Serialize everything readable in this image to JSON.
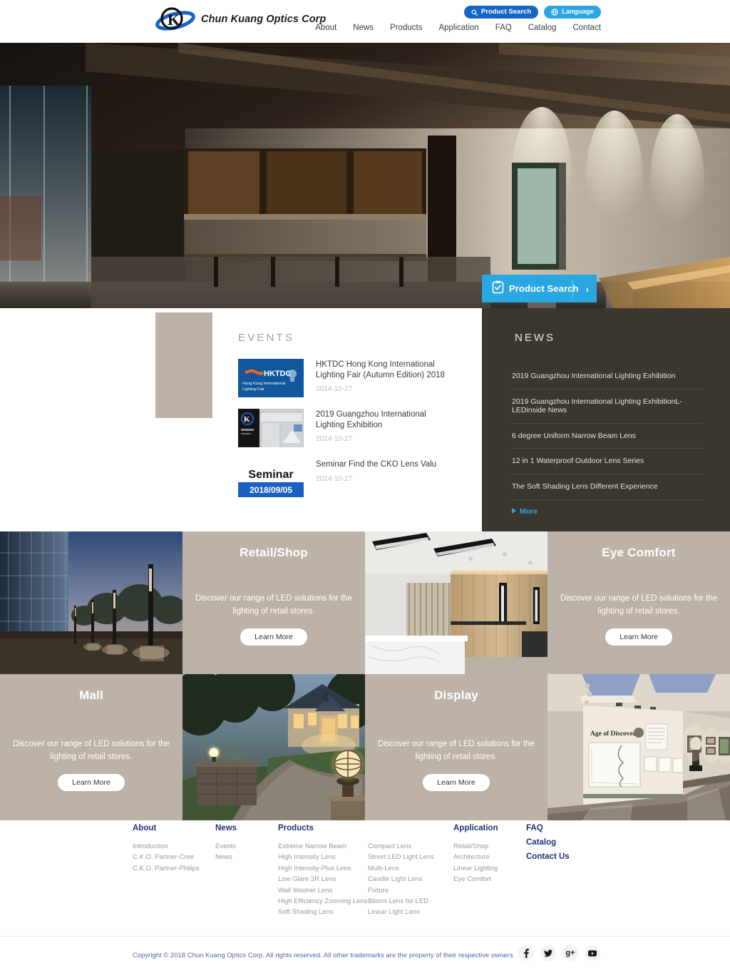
{
  "header": {
    "logo_text": "Chun Kuang Optics Corp",
    "buttons": [
      {
        "label": "Product Search",
        "icon": "search-icon",
        "color": "#1565c7"
      },
      {
        "label": "Language",
        "icon": "globe-icon",
        "color": "#2aa6e0"
      }
    ],
    "nav": [
      {
        "label": "About"
      },
      {
        "label": "News"
      },
      {
        "label": "Products"
      },
      {
        "label": "Application"
      },
      {
        "label": "FAQ"
      },
      {
        "label": "Catalog"
      },
      {
        "label": "Contact"
      }
    ]
  },
  "hero": {
    "cta_label": "Product Search",
    "cta_icon": "clipboard-check-icon",
    "cta_chevron": "›",
    "cta_color": "#2aa6e0"
  },
  "events": {
    "title": "EVENTS",
    "items": [
      {
        "title": "HKTDC Hong Kong International Lighting Fair (Autumn Edition) 2018",
        "date": "2014-10-27",
        "thumb_kind": "hktdc",
        "thumb_text": "HKTDC",
        "thumb_sub": "Hong Kong International Lighting Fair"
      },
      {
        "title": "2019 Guangzhou International Lighting Exhibition",
        "date": "2014-10-27",
        "thumb_kind": "booth",
        "thumb_text": "",
        "thumb_sub": ""
      },
      {
        "title": "Seminar Find the CKO Lens Valu",
        "date": "2014-10-27",
        "thumb_kind": "seminar",
        "thumb_text": "Seminar",
        "thumb_sub": "2018/09/05"
      }
    ]
  },
  "news": {
    "title": "NEWS",
    "items": [
      {
        "label": "2019 Guangzhou International Lighting Exhibition"
      },
      {
        "label": "2019 Guangzhou International Lighting ExhibitionL-LEDinside News"
      },
      {
        "label": "6 degree Uniform Narrow Beam Lens"
      },
      {
        "label": "12 in 1 Waterproof Outdoor Lens Series"
      },
      {
        "label": "The Soft Shading Lens Different Experience"
      }
    ],
    "more_label": "More",
    "more_color": "#2aa6e0"
  },
  "tiles": [
    {
      "kind": "image",
      "image": "outdoor-poles",
      "title": "",
      "desc": "",
      "button": ""
    },
    {
      "kind": "text",
      "title": "Retail/Shop",
      "desc": "Discover our range of LED solutions for the lighting of retail stores.",
      "button": "Learn More"
    },
    {
      "kind": "image",
      "image": "office-interior",
      "title": "",
      "desc": "",
      "button": ""
    },
    {
      "kind": "text",
      "title": "Eye Comfort",
      "desc": "Discover our range of LED solutions for the lighting of retail stores.",
      "button": "Learn More"
    },
    {
      "kind": "text",
      "title": "Mall",
      "desc": "Discover our range of LED solutions for the lighting of retail stores.",
      "button": "Learn More"
    },
    {
      "kind": "image",
      "image": "house-garden",
      "title": "",
      "desc": "",
      "button": ""
    },
    {
      "kind": "text",
      "title": "Display",
      "desc": "Discover our range of LED solutions for the lighting of retail stores.",
      "button": "Learn More"
    },
    {
      "kind": "image",
      "image": "museum-gallery",
      "title": "",
      "desc": "",
      "button": ""
    }
  ],
  "footer": {
    "columns": [
      {
        "head": "About",
        "links": [
          "Introduction",
          "C.K.O. Partner-Cree",
          "C.K.O. Partner-Philips"
        ]
      },
      {
        "head": "News",
        "links": [
          "Events",
          "News"
        ]
      }
    ],
    "products": {
      "head": "Products",
      "col_a": [
        "Extreme Narrow Beam",
        "High Intensity Lens",
        "High Intensity-Plus Lens",
        "Low Glare 3R Lens",
        "Wall Washer Lens",
        "High Efficiency Zooming Lens",
        "Soft Shading Lens"
      ],
      "col_b": [
        "Compact Lens",
        "Street LED Light Lens",
        "Multi-Lens",
        "Candle Light Lens",
        "Fixture",
        "Bloom Lens for LED",
        "Linear Light Lens"
      ]
    },
    "application": {
      "head": "Application",
      "links": [
        "Retail/Shop",
        "Architecture",
        "Linear Lighting",
        "Eye Comfort"
      ]
    },
    "solo_links": [
      "FAQ",
      "Catalog",
      "Contact Us"
    ],
    "copyright": "Copyright © 2018 Chun Kuang Optics Corp. All rights reserved. All other trademarks are the property of their respective owners.",
    "socials": [
      {
        "name": "facebook-icon",
        "glyph": "f"
      },
      {
        "name": "twitter-icon",
        "glyph": "t"
      },
      {
        "name": "google-plus-icon",
        "glyph": "g+"
      },
      {
        "name": "youtube-icon",
        "glyph": "yt"
      }
    ]
  }
}
